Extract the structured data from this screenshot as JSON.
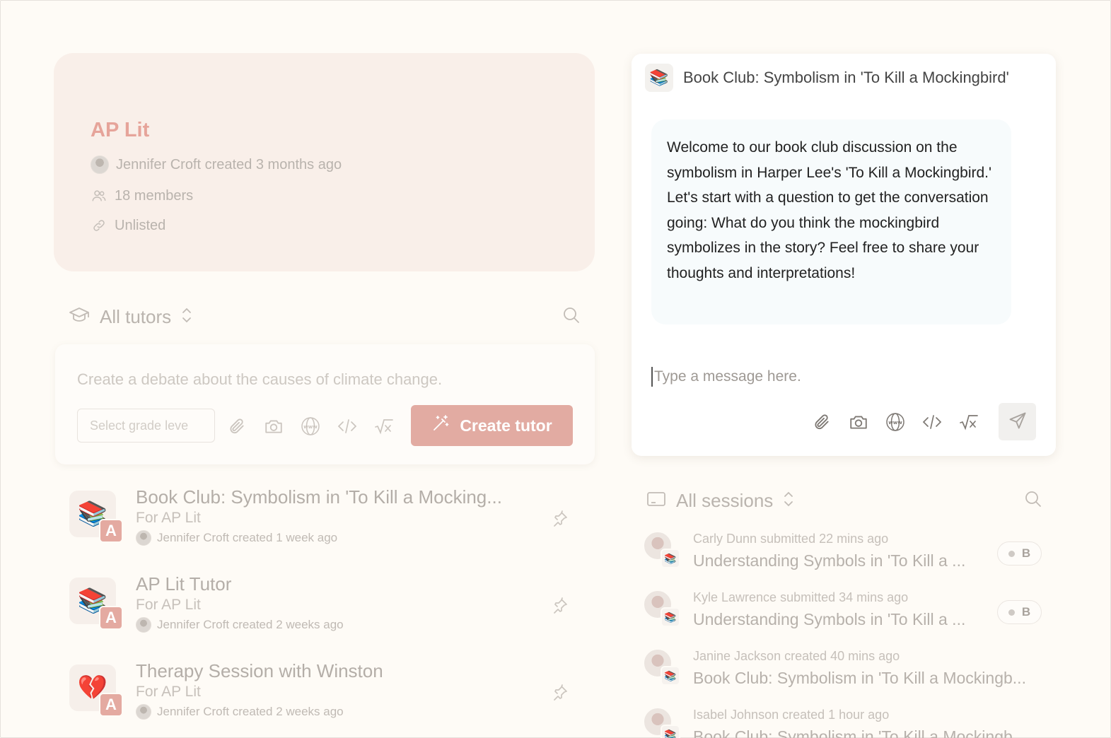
{
  "class_card": {
    "title": "AP Lit",
    "creator_line": "Jennifer Croft created 3 months ago",
    "members": "18 members",
    "visibility": "Unlisted"
  },
  "tutors": {
    "header_label": "All tutors",
    "composer_placeholder": "Create a debate about the causes of climate change.",
    "grade_placeholder": "Select grade leve",
    "create_button": "Create tutor",
    "items": [
      {
        "icon": "books-icon",
        "emoji": "📚",
        "badge": "A",
        "title": "Book Club: Symbolism in 'To Kill a Mocking...",
        "subtitle": "For AP Lit",
        "meta": "Jennifer Croft created 1 week ago"
      },
      {
        "icon": "books-icon",
        "emoji": "📚",
        "badge": "A",
        "title": "AP Lit Tutor",
        "subtitle": "For AP Lit",
        "meta": "Jennifer Croft created 2 weeks ago"
      },
      {
        "icon": "broken-heart-icon",
        "emoji": "💔",
        "badge": "A",
        "title": "Therapy Session with Winston",
        "subtitle": "For AP Lit",
        "meta": "Jennifer Croft created 2 weeks ago"
      }
    ]
  },
  "chat": {
    "title": "Book Club: Symbolism in 'To Kill a Mockingbird'",
    "message": "Welcome to our book club discussion on the symbolism in Harper Lee's 'To Kill a Mockingbird.' Let's start with a question to get the conversation going: What do you think the mockingbird symbolizes in the story? Feel free to share your thoughts and interpretations!",
    "input_placeholder": "Type a message here."
  },
  "sessions": {
    "header_label": "All sessions",
    "items": [
      {
        "meta": "Carly Dunn submitted 22 mins ago",
        "title": "Understanding Symbols in 'To Kill a ...",
        "grade": "B"
      },
      {
        "meta": "Kyle Lawrence submitted 34 mins ago",
        "title": "Understanding Symbols in 'To Kill a ...",
        "grade": "B"
      },
      {
        "meta": "Janine Jackson created 40 mins ago",
        "title": "Book Club: Symbolism in 'To Kill a Mockingb...",
        "grade": ""
      },
      {
        "meta": "Isabel Johnson created 1 hour ago",
        "title": "Book Club: Symbolism in 'To Kill a Mockingb...",
        "grade": ""
      }
    ]
  },
  "colors": {
    "accent": "#e2aba2",
    "background": "#fefbf6",
    "class_card": "#f9efe9"
  }
}
